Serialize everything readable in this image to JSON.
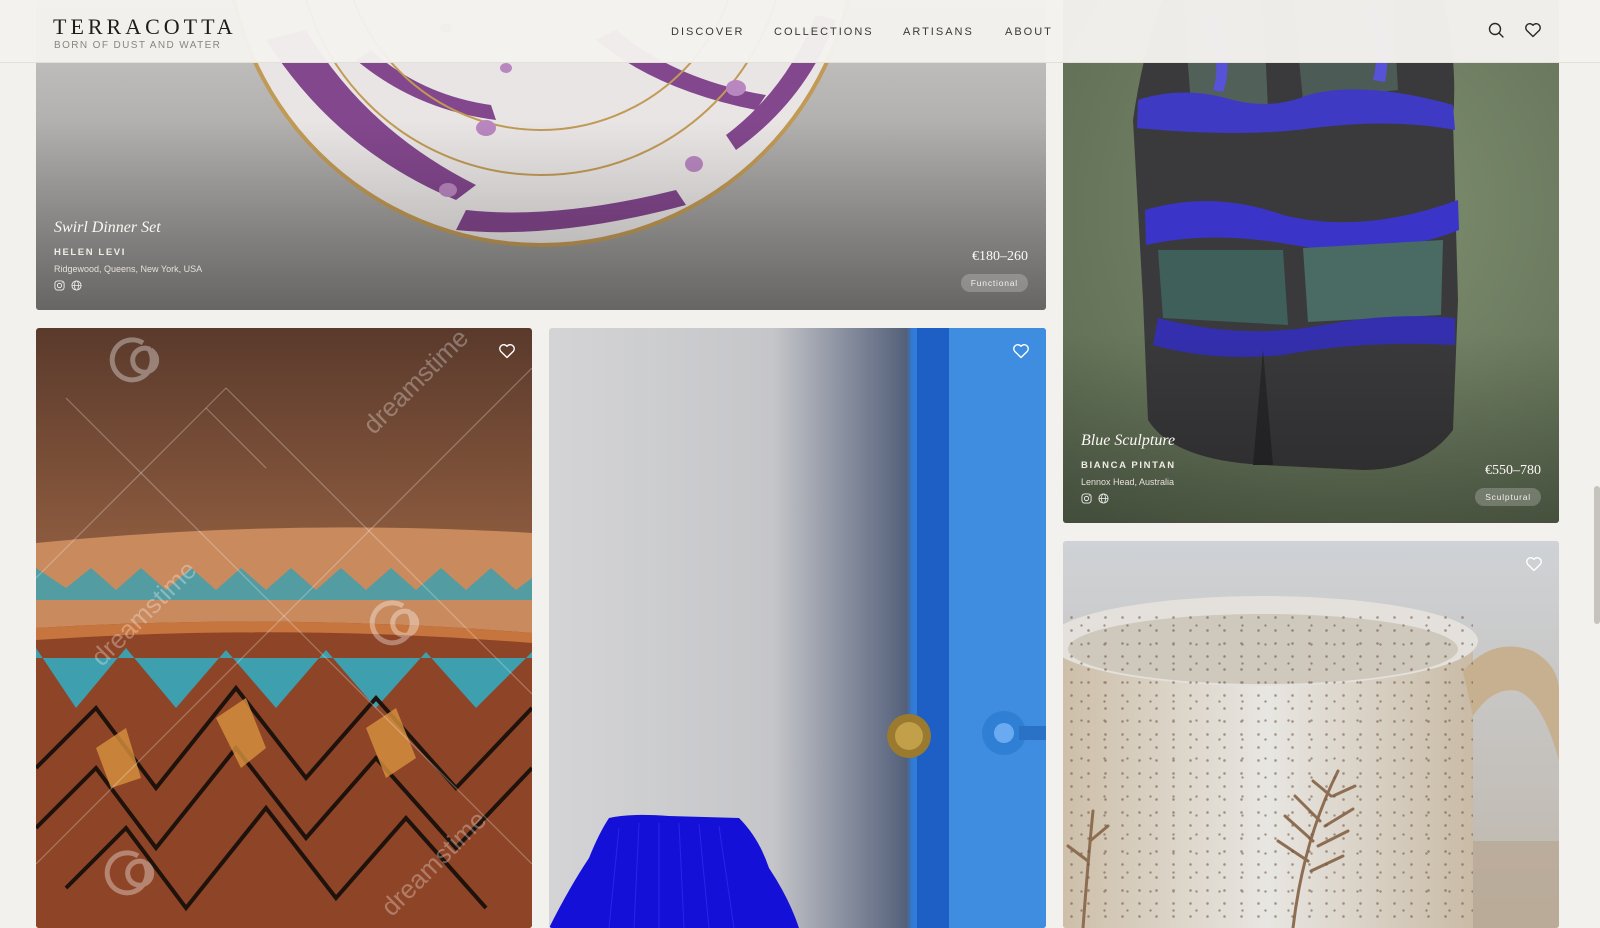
{
  "brand": {
    "title": "TERRACOTTA",
    "tagline": "BORN OF DUST AND WATER"
  },
  "nav": [
    "DISCOVER",
    "COLLECTIONS",
    "ARTISANS",
    "ABOUT"
  ],
  "header_icons": [
    "search-icon",
    "heart-icon"
  ],
  "cards": {
    "swirl": {
      "title": "Swirl Dinner Set",
      "artisan": "HELEN LEVI",
      "location": "Ridgewood, Queens, New York, USA",
      "price": "€180–260",
      "tag": "Functional"
    },
    "blue": {
      "title": "Blue Sculpture",
      "artisan": "BIANCA PINTAN",
      "location": "Lennox Head, Australia",
      "price": "€550–780",
      "tag": "Sculptural"
    }
  },
  "watermark": "dreamstime",
  "colors": {
    "background": "#f3f1ed",
    "plate_purple": "#7a3a86",
    "sculpture_blue": "#3a35c8",
    "vase_blue": "#1510d8",
    "door_blue": "#2d78d6",
    "bowl_terracotta": "#8e4426",
    "bowl_teal": "#3e9fae"
  }
}
